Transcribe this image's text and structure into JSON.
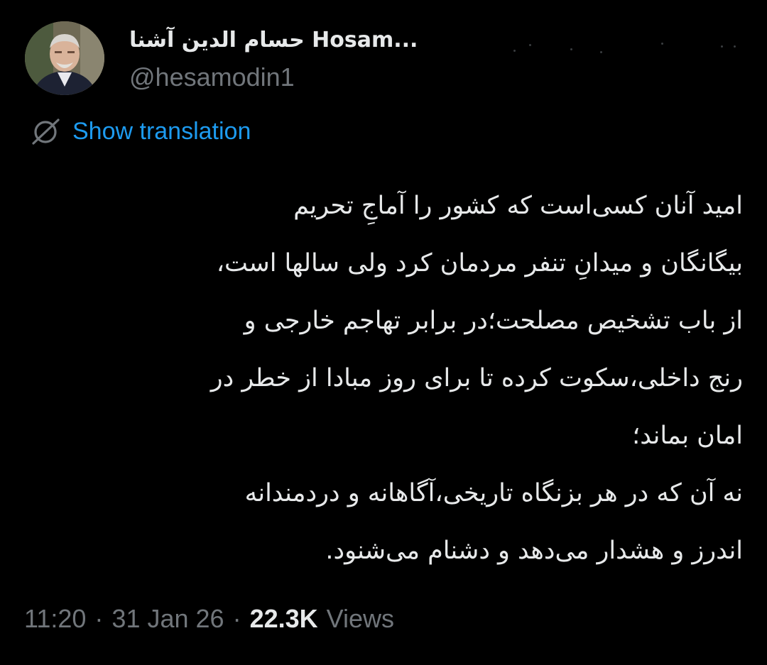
{
  "tweet": {
    "display_name": "حسام الدين آشنا Hosam...",
    "handle": "@hesamodin1",
    "translate_label": "Show translation",
    "body_lines": [
      "امید آنان کسی‌است که کشور را آماجِ تحریم",
      "بیگانگان و میدانِ تنفر مردمان کرد ولی سالها است،",
      "از باب تشخیص مصلحت؛در برابر تهاجم خارجی و",
      "رنج داخلی،سکوت کرده تا برای روز مبادا از خطر در",
      "امان بماند؛",
      "نه آن که در هر بزنگاه تاریخی،آگاهانه و دردمندانه",
      "اندرز و هشدار می‌دهد و دشنام می‌شنود."
    ],
    "time": "11:20",
    "date": "31 Jan 26",
    "separator": "·",
    "views_count": "22.3K",
    "views_label": "Views"
  },
  "icons": {
    "avatar": "profile-photo",
    "translate": "translate-globe-icon",
    "more": "more-options-icon"
  },
  "colors": {
    "background": "#000000",
    "text_primary": "#e7e9ea",
    "text_secondary": "#71767b",
    "accent": "#1d9bf0"
  }
}
